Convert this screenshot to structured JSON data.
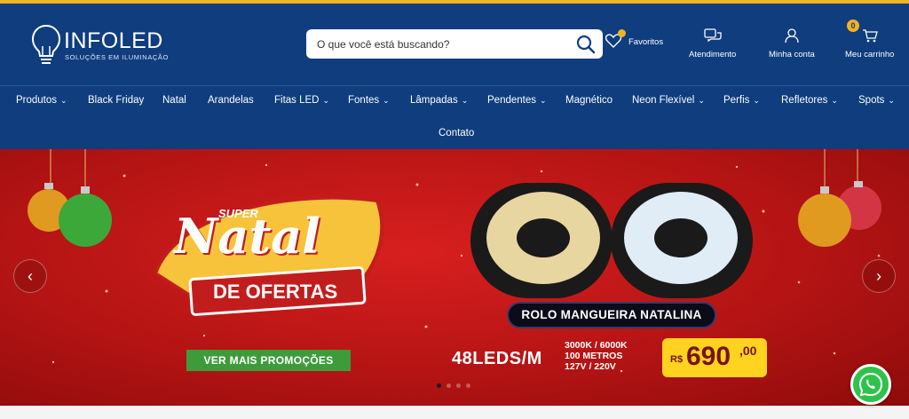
{
  "colors": {
    "accent": "#f2b320",
    "header_bg": "#0f3d7e",
    "banner_red": "#c41a1a",
    "cta_green": "#3e9b3a",
    "price_yellow": "#ffd31f"
  },
  "header": {
    "brand": "INFOLED",
    "tagline": "Soluções em Iluminação",
    "search": {
      "placeholder": "O que você está buscando?",
      "value": "",
      "icon": "search-icon"
    },
    "favorites": {
      "label": "Favoritos",
      "icon": "heart-icon"
    },
    "service": {
      "label": "Atendimento",
      "icon": "chat-icon"
    },
    "account": {
      "label": "Minha conta",
      "icon": "user-icon"
    },
    "cart": {
      "label": "Meu carrinho",
      "icon": "cart-icon",
      "count": "0"
    }
  },
  "nav": {
    "items": [
      {
        "label": "Produtos",
        "dropdown": true
      },
      {
        "label": "Black Friday",
        "dropdown": false
      },
      {
        "label": "Natal",
        "dropdown": false
      },
      {
        "label": "Arandelas",
        "dropdown": false
      },
      {
        "label": "Fitas LED",
        "dropdown": true
      },
      {
        "label": "Fontes",
        "dropdown": true
      },
      {
        "label": "Lâmpadas",
        "dropdown": true
      },
      {
        "label": "Pendentes",
        "dropdown": true
      },
      {
        "label": "Magnético",
        "dropdown": false
      },
      {
        "label": "Neon Flexível",
        "dropdown": true
      },
      {
        "label": "Perfis",
        "dropdown": true
      },
      {
        "label": "Refletores",
        "dropdown": true
      },
      {
        "label": "Spots",
        "dropdown": true
      },
      {
        "label": "Contato",
        "dropdown": false
      }
    ]
  },
  "banner": {
    "headline_top": "SUPER",
    "headline_main": "Natal",
    "headline_sub": "DE OFERTAS",
    "cta": "VER MAIS PROMOÇÕES",
    "product_name": "ROLO MANGUEIRA NATALINA",
    "leds": "48LEDS/M",
    "specs": [
      "3000K / 6000K",
      "100 METROS",
      "127V / 220V"
    ],
    "price": {
      "currency": "R$",
      "integer": "690",
      "cents": ",00"
    },
    "slides": 4,
    "active_slide": 1
  },
  "whatsapp": {
    "icon": "whatsapp-icon"
  }
}
